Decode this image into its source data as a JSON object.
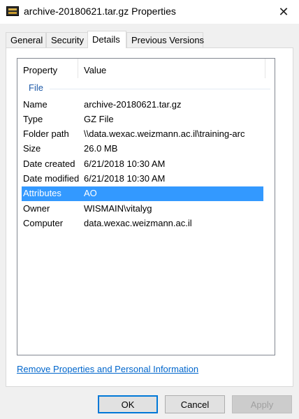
{
  "window": {
    "title": "archive-20180621.tar.gz Properties",
    "app_icon": "archive-icon",
    "close_label": "✕"
  },
  "tabs": [
    {
      "label": "General",
      "active": false
    },
    {
      "label": "Security",
      "active": false
    },
    {
      "label": "Details",
      "active": true
    },
    {
      "label": "Previous Versions",
      "active": false
    }
  ],
  "details": {
    "columns": {
      "property": "Property",
      "value": "Value"
    },
    "group": "File",
    "rows": [
      {
        "key": "Name",
        "value": "archive-20180621.tar.gz"
      },
      {
        "key": "Type",
        "value": "GZ File"
      },
      {
        "key": "Folder path",
        "value": "\\\\data.wexac.weizmann.ac.il\\training-arc"
      },
      {
        "key": "Size",
        "value": "26.0 MB"
      },
      {
        "key": "Date created",
        "value": "6/21/2018 10:30 AM"
      },
      {
        "key": "Date modified",
        "value": "6/21/2018 10:30 AM"
      },
      {
        "key": "Attributes",
        "value": "AO",
        "selected": true
      },
      {
        "key": "Owner",
        "value": "WISMAIN\\vitalyg"
      },
      {
        "key": "Computer",
        "value": "data.wexac.weizmann.ac.il"
      }
    ]
  },
  "remove_link": "Remove Properties and Personal Information",
  "buttons": {
    "ok": "OK",
    "cancel": "Cancel",
    "apply": "Apply"
  },
  "colors": {
    "selection": "#3399ff",
    "link": "#0066cc",
    "group": "#1e5aa8"
  }
}
